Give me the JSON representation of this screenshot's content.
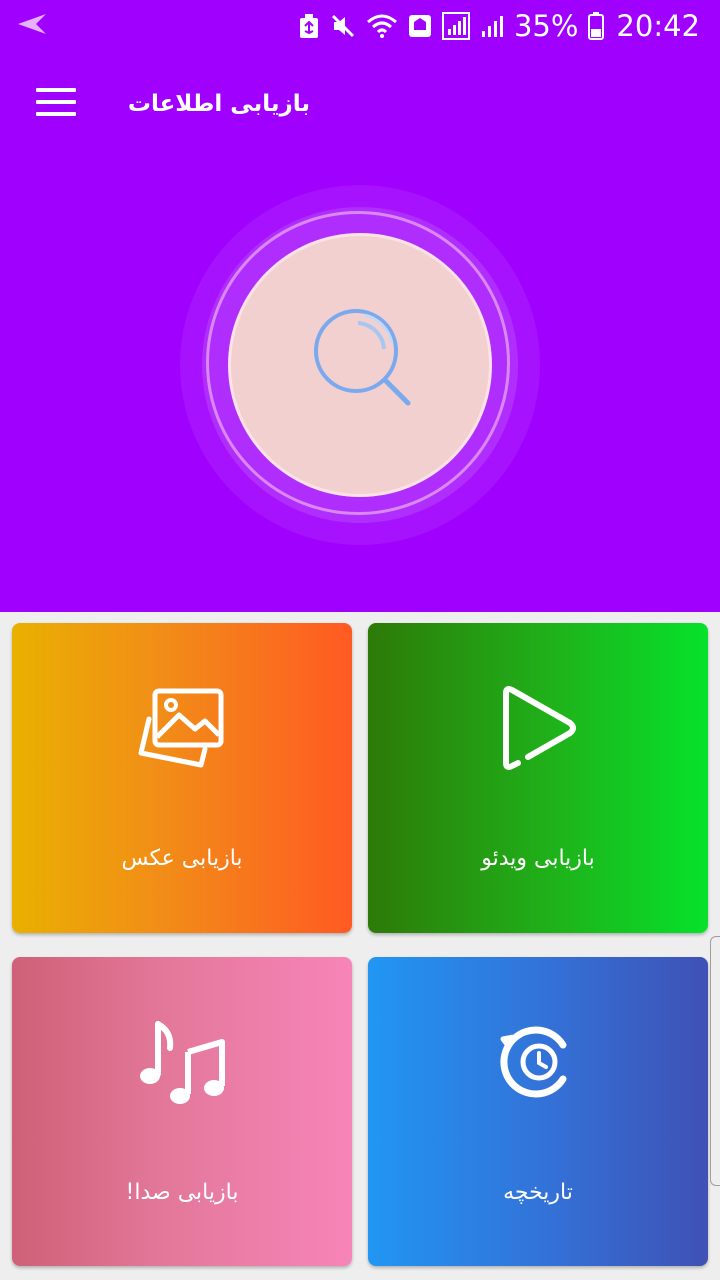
{
  "status_bar": {
    "battery_percent": "35%",
    "time": "20:42",
    "icons": [
      "back-arrow-icon",
      "recycle-notification-icon",
      "mute-icon",
      "wifi-icon",
      "nfc-icon",
      "signal-sim1-icon",
      "signal-sim2-icon",
      "battery-icon"
    ]
  },
  "app_bar": {
    "title": "بازیابی اطلاعات",
    "menu_icon": "hamburger-menu-icon"
  },
  "scan": {
    "icon": "magnifier-search-icon"
  },
  "cards": {
    "photo": {
      "label": "بازیابی عکس",
      "icon": "photo-gallery-icon"
    },
    "video": {
      "label": "بازیابی ویدئو",
      "icon": "play-icon"
    },
    "audio": {
      "label": "بازیابی صدا!",
      "icon": "music-notes-icon"
    },
    "history": {
      "label": "تاریخچه",
      "icon": "history-clock-icon"
    }
  },
  "colors": {
    "header_bg": "#a000fd",
    "scan_circle": "#f3d0d0",
    "search_icon": "#7aa9ee"
  }
}
